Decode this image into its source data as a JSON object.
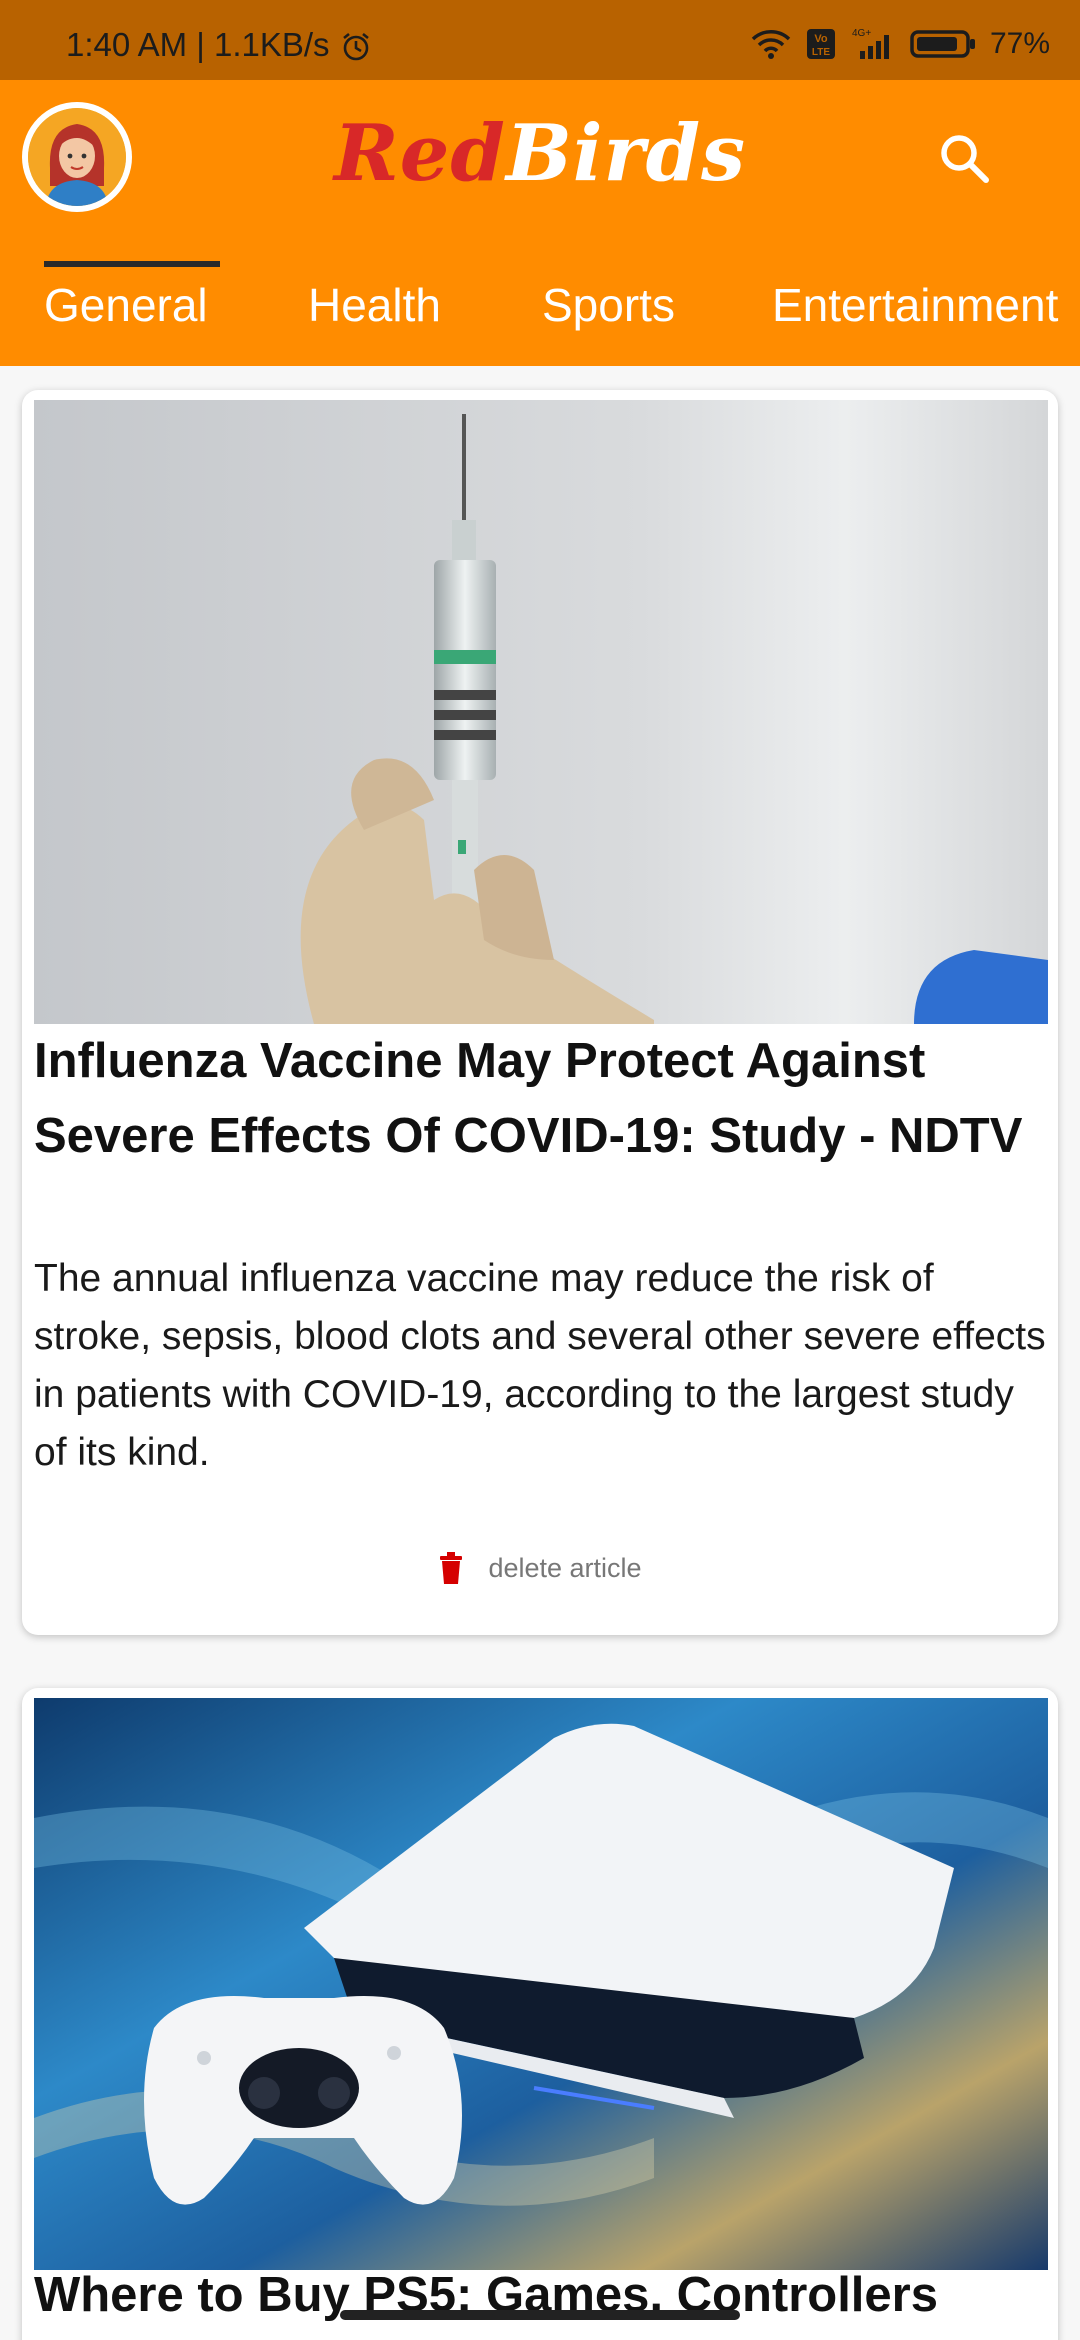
{
  "status_bar": {
    "time": "1:40 AM | 1.1KB/s",
    "network": "4G+",
    "battery": "77%"
  },
  "app_bar": {
    "brand_part1": "Red",
    "brand_part2": "Birds",
    "brand_color": "#d82828",
    "accent": "#ff8c00"
  },
  "tabs": [
    "General",
    "Health",
    "Sports",
    "Entertainment"
  ],
  "selected_tab": "General",
  "articles": [
    {
      "title": "Influenza Vaccine May Protect Against Severe Effects Of COVID-19: Study - NDTV",
      "description": "The annual influenza vaccine may reduce the risk of stroke, sepsis, blood clots and several other severe effects in patients with COVID-19, according to the largest study of its kind.",
      "action_label": "delete article",
      "image_icon": "syringe-image"
    },
    {
      "title": "Where to Buy PS5: Games, Controllers",
      "image_icon": "console-image"
    }
  ]
}
